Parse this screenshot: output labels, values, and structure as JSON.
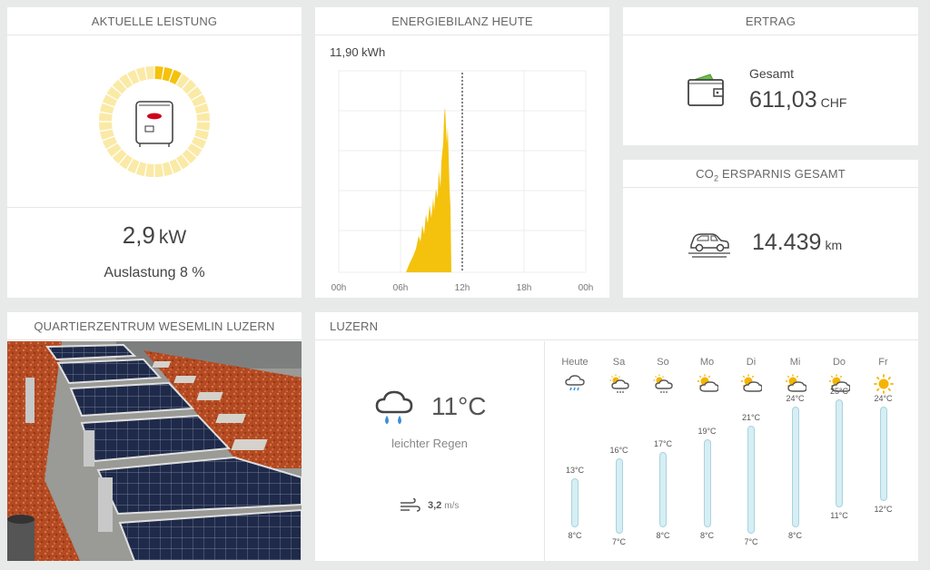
{
  "power": {
    "header": "AKTUELLE LEISTUNG",
    "value": "2,9",
    "unit": "kW",
    "utilization": "Auslastung 8 %",
    "utilization_fraction": 0.08,
    "colors": {
      "gauge_active": "#f4c20d",
      "gauge_bg": "#faeaa6"
    }
  },
  "energy": {
    "header": "ENERGIEBILANZ HEUTE",
    "max_label": "11,90 kWh",
    "x_ticks": [
      "00h",
      "06h",
      "12h",
      "18h",
      "00h"
    ],
    "colors": {
      "fill": "#f4c20d"
    }
  },
  "yield": {
    "header": "ERTRAG",
    "label": "Gesamt",
    "value": "611,03",
    "unit": "CHF"
  },
  "co2": {
    "header_prefix": "CO",
    "header_sub": "2",
    "header_suffix": " ERSPARNIS GESAMT",
    "value": "14.439",
    "unit": "km"
  },
  "photo": {
    "header": "QUARTIERZENTRUM WESEMLIN LUZERN"
  },
  "weather": {
    "header": "LUZERN",
    "current": {
      "temp": "11°C",
      "description": "leichter Regen",
      "icon": "rain-cloud-icon",
      "wind_value": "3,2",
      "wind_unit": "m/s"
    },
    "forecast": [
      {
        "day": "Heute",
        "icon": "rain-icon",
        "max": "13°C",
        "min": "8°C",
        "max_val": 13,
        "min_val": 8
      },
      {
        "day": "Sa",
        "icon": "sun-cloud-rain-icon",
        "max": "16°C",
        "min": "7°C",
        "max_val": 16,
        "min_val": 7
      },
      {
        "day": "So",
        "icon": "sun-cloud-rain-icon",
        "max": "17°C",
        "min": "8°C",
        "max_val": 17,
        "min_val": 8
      },
      {
        "day": "Mo",
        "icon": "sun-cloud-icon",
        "max": "19°C",
        "min": "8°C",
        "max_val": 19,
        "min_val": 8
      },
      {
        "day": "Di",
        "icon": "sun-cloud-icon",
        "max": "21°C",
        "min": "7°C",
        "max_val": 21,
        "min_val": 7
      },
      {
        "day": "Mi",
        "icon": "sun-cloud-icon",
        "max": "24°C",
        "min": "8°C",
        "max_val": 24,
        "min_val": 8
      },
      {
        "day": "Do",
        "icon": "sun-cloud-icon",
        "max": "25°C",
        "min": "11°C",
        "max_val": 25,
        "min_val": 11
      },
      {
        "day": "Fr",
        "icon": "sun-icon",
        "max": "24°C",
        "min": "12°C",
        "max_val": 24,
        "min_val": 12
      }
    ]
  }
}
